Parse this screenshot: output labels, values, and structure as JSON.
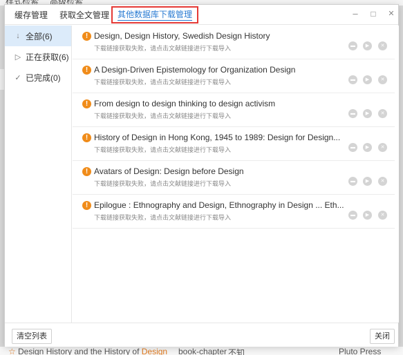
{
  "background": {
    "top_tab1": "样式检索",
    "top_tab2": "高级检索",
    "bottom_title_pre": "Design History and the History of ",
    "bottom_title_hl": "Design",
    "bottom_type": "book-chapter",
    "bottom_unknown": "不知",
    "bottom_publisher": "Pluto Press"
  },
  "tabs": [
    {
      "label": "缓存管理"
    },
    {
      "label": "获取全文管理"
    },
    {
      "label": "其他数据库下载管理"
    }
  ],
  "window": {
    "minimize": "–",
    "maximize": "□",
    "close": "✕"
  },
  "sidebar": {
    "items": [
      {
        "icon": "↓",
        "label": "全部(6)"
      },
      {
        "icon": "▷",
        "label": "正在获取(6)"
      },
      {
        "icon": "✓",
        "label": "已完成(0)"
      }
    ]
  },
  "rows": [
    {
      "title": "Design, Design History, Swedish Design History",
      "status": "下载链接获取失败，请点击文献链接进行下载导入"
    },
    {
      "title": "A Design-Driven Epistemology for Organization Design",
      "status": "下载链接获取失败，请点击文献链接进行下载导入"
    },
    {
      "title": "From design to design thinking to design activism",
      "status": "下载链接获取失败，请点击文献链接进行下载导入"
    },
    {
      "title": "History of Design in Hong Kong, 1945 to 1989: Design for Design...",
      "status": "下载链接获取失败，请点击文献链接进行下载导入"
    },
    {
      "title": "Avatars of Design: Design before Design",
      "status": "下载链接获取失败，请点击文献链接进行下载导入"
    },
    {
      "title": "Epilogue : Ethnography and Design, Ethnography in Design ... Eth...",
      "status": "下载链接获取失败，请点击文献链接进行下载导入"
    }
  ],
  "warn_symbol": "!",
  "footer": {
    "clear_label": "清空列表",
    "close_label": "关闭"
  },
  "colors": {
    "accent": "#2b7cd3",
    "highlight_border": "#e53935",
    "warning": "#f08c1a",
    "sidebar_active": "#dcebfa"
  }
}
